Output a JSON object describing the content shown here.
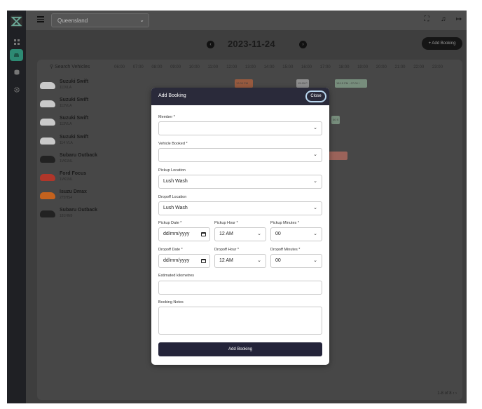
{
  "topbar": {
    "region": "Queensland",
    "icons": [
      "hamburger-icon",
      "fullscreen-icon",
      "bell-icon",
      "logout-icon"
    ]
  },
  "sidebar": {
    "items": [
      {
        "icon": "dashboard-icon",
        "active": false
      },
      {
        "icon": "car-icon",
        "active": true
      },
      {
        "icon": "database-icon",
        "active": false
      },
      {
        "icon": "settings-icon",
        "active": false
      }
    ]
  },
  "schedule": {
    "date": "2023-11-24",
    "add_button": "+ Add Booking",
    "search_placeholder": "Search Vehicles",
    "hours": [
      "06:00",
      "07:00",
      "08:00",
      "09:00",
      "10:00",
      "11:00",
      "12:00",
      "13:00",
      "14:00",
      "15:00",
      "16:00",
      "17:00",
      "18:00",
      "19:00",
      "20:00",
      "21:00",
      "22:00",
      "23:00"
    ],
    "vehicles": [
      {
        "name": "Suzuki Swift",
        "plate": "111VLA",
        "color": "#c9c9c9"
      },
      {
        "name": "Suzuki Swift",
        "plate": "112VLA",
        "color": "#c9c9c9"
      },
      {
        "name": "Suzuki Swift",
        "plate": "113VLA",
        "color": "#c9c9c9"
      },
      {
        "name": "Suzuki Swift",
        "plate": "114 VLA",
        "color": "#c9c9c9"
      },
      {
        "name": "Subaru Outback",
        "plate": "1VK1NL",
        "color": "#222222"
      },
      {
        "name": "Ford Focus",
        "plate": "1VK1NL",
        "color": "#b0362a"
      },
      {
        "name": "Isuzu Dmax",
        "plate": "275HS4",
        "color": "#c4621e"
      },
      {
        "name": "Subaru Outback",
        "plate": "181HN9",
        "color": "#222222"
      }
    ],
    "bookings": [
      {
        "label": "12:00 PM",
        "color": "#d96a3a"
      },
      {
        "label": "15:15 P",
        "color": "#c8c8c8"
      },
      {
        "label": "18:15 PM - 07:00 I",
        "color": "#9fc7a8"
      },
      {
        "label": "00 S",
        "color": "#9fc7a8"
      },
      {
        "label": "",
        "color": "#e07a6a"
      }
    ],
    "pager": "1-8 of 8"
  },
  "modal": {
    "title": "Add Booking",
    "close": "Close",
    "member_label": "Member *",
    "member_value": "",
    "vehicle_label": "Vehicle Booked *",
    "vehicle_value": "",
    "pickup_location_label": "Pickup Location",
    "pickup_location_value": "Lush Wash",
    "dropoff_location_label": "Dropoff Location",
    "dropoff_location_value": "Lush Wash",
    "pickup_date_label": "Pickup Date *",
    "pickup_date_value": "dd/mm/yyyy",
    "pickup_hour_label": "Pickup Hour *",
    "pickup_hour_value": "12 AM",
    "pickup_minutes_label": "Pickup Minutes *",
    "pickup_minutes_value": "00",
    "dropoff_date_label": "Dropoff Date *",
    "dropoff_date_value": "dd/mm/yyyy",
    "dropoff_hour_label": "Dropoff Hour *",
    "dropoff_hour_value": "12 AM",
    "dropoff_minutes_label": "Dropoff Minutes *",
    "dropoff_minutes_value": "00",
    "km_label": "Estimated kilometres",
    "km_value": "",
    "notes_label": "Booking Notes",
    "notes_value": "",
    "submit": "Add Booking"
  }
}
